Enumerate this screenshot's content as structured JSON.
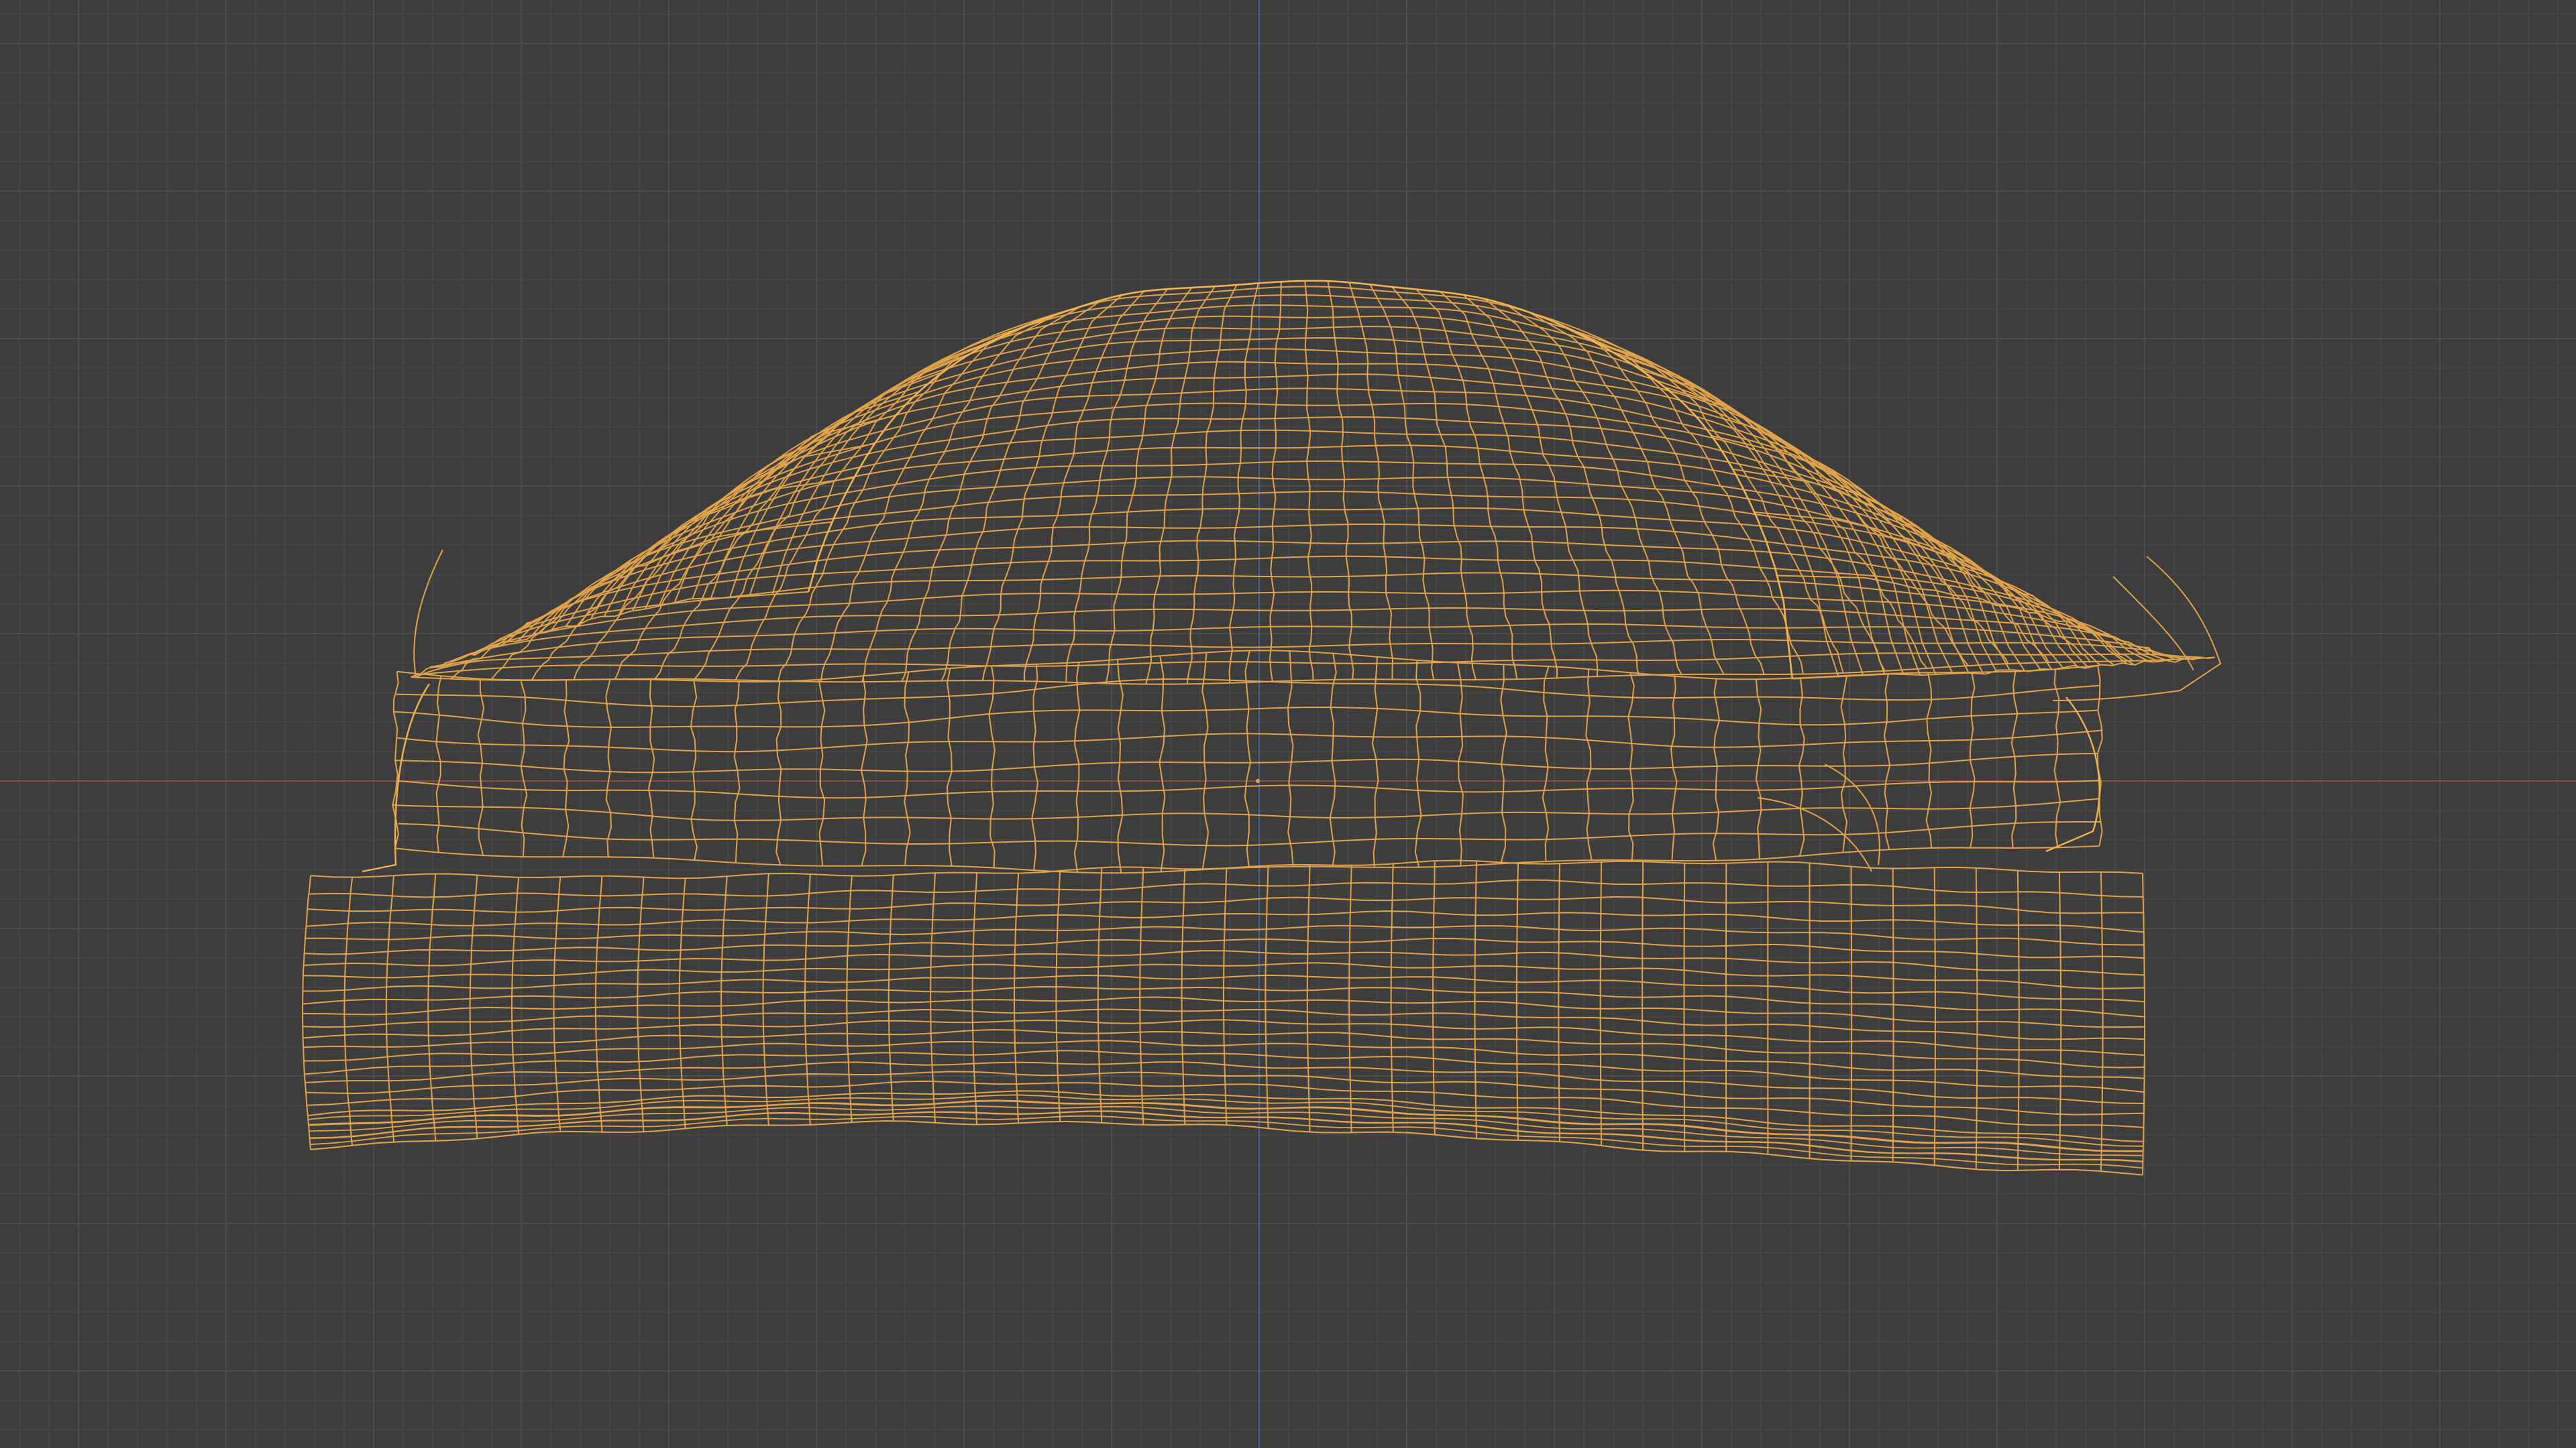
{
  "viewport": {
    "view": "front-orthographic",
    "display_mode": "wireframe",
    "object": "burger-mesh",
    "object_selected": true
  },
  "colors": {
    "background": "#3d3d3d",
    "grid_minor": "#474747",
    "grid_major": "#4d4d4d",
    "axis_x": "#8a4b4b",
    "axis_z": "#4b6590",
    "wire": "#e0a24a",
    "wire_outline": "#f0b253",
    "origin": "#e0a24a"
  }
}
